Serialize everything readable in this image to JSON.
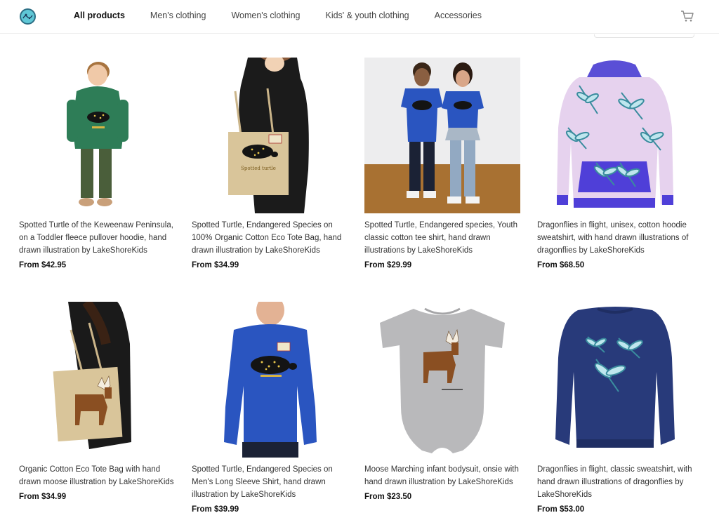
{
  "header": {
    "logo_alt": "LakeShoreKids",
    "nav": [
      {
        "label": "All products",
        "active": true
      },
      {
        "label": "Men's clothing",
        "active": false
      },
      {
        "label": "Women's clothing",
        "active": false
      },
      {
        "label": "Kids' & youth clothing",
        "active": false
      },
      {
        "label": "Accessories",
        "active": false
      }
    ],
    "cart_icon": "shopping-cart-icon"
  },
  "products": [
    {
      "title": "Spotted Turtle of the Keweenaw Peninsula, on a Toddler fleece pullover hoodie, hand drawn illustration by LakeShoreKids",
      "price": "From $42.95"
    },
    {
      "title": "Spotted Turtle, Endangered Species on 100% Organic Cotton Eco Tote Bag, hand drawn illustration by LakeShoreKids",
      "price": "From $34.99"
    },
    {
      "title": "Spotted Turtle, Endangered species, Youth classic cotton tee shirt, hand drawn illustrations by LakeShoreKids",
      "price": "From $29.99"
    },
    {
      "title": "Dragonflies in flight, unisex, cotton hoodie sweatshirt, with hand drawn illustrations of dragonflies by LakeShoreKids",
      "price": "From $68.50"
    },
    {
      "title": "Organic Cotton Eco Tote Bag with hand drawn moose illustration by LakeShoreKids",
      "price": "From $34.99"
    },
    {
      "title": "Spotted Turtle, Endangered Species on Men's Long Sleeve Shirt, hand drawn illustration by LakeShoreKids",
      "price": "From $39.99"
    },
    {
      "title": "Moose Marching infant bodysuit, onsie with hand drawn illustration by LakeShoreKids",
      "price": "From $23.50"
    },
    {
      "title": "Dragonflies in flight, classic sweatshirt, with hand drawn illustrations of dragonflies by LakeShoreKids",
      "price": "From $53.00"
    }
  ],
  "image_text": {
    "turtle_label": "Spotted turtle"
  },
  "colors": {
    "accent": "#5fc7d6",
    "hoodie_green": "#2e7d57",
    "royal_blue": "#2a55c0",
    "navy": "#283a7a",
    "lavender": "#e6d2ee",
    "heather_grey": "#b9b9bb",
    "tote_tan": "#d9c59a"
  }
}
